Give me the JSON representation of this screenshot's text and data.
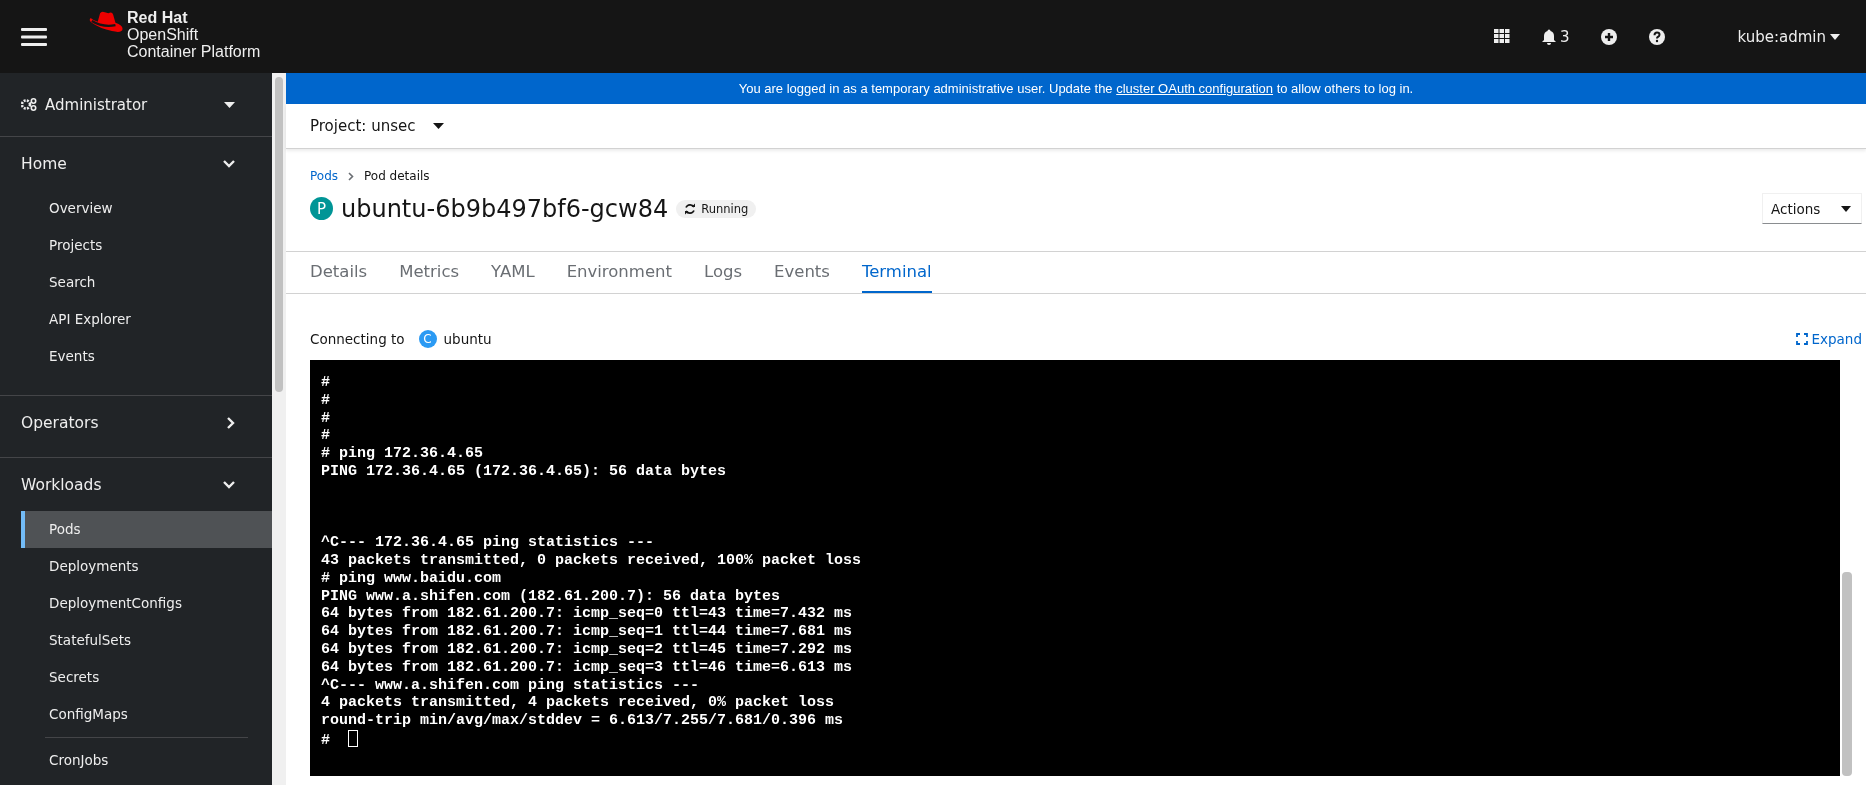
{
  "masthead": {
    "brand": "Red Hat",
    "product": "OpenShift",
    "product_sub": "Container Platform",
    "notifications": "3",
    "user": "kube:admin"
  },
  "sidebar": {
    "perspective": "Administrator",
    "sections": [
      {
        "label": "Home",
        "expanded": true,
        "items": [
          {
            "label": "Overview",
            "selected": false,
            "divider_before": false
          },
          {
            "label": "Projects",
            "selected": false,
            "divider_before": false
          },
          {
            "label": "Search",
            "selected": false,
            "divider_before": false
          },
          {
            "label": "API Explorer",
            "selected": false,
            "divider_before": false
          },
          {
            "label": "Events",
            "selected": false,
            "divider_before": false
          }
        ]
      },
      {
        "label": "Operators",
        "expanded": false
      },
      {
        "label": "Workloads",
        "expanded": true,
        "items": [
          {
            "label": "Pods",
            "selected": true,
            "divider_before": false
          },
          {
            "label": "Deployments",
            "selected": false,
            "divider_before": false
          },
          {
            "label": "DeploymentConfigs",
            "selected": false,
            "divider_before": false
          },
          {
            "label": "StatefulSets",
            "selected": false,
            "divider_before": false
          },
          {
            "label": "Secrets",
            "selected": false,
            "divider_before": false
          },
          {
            "label": "ConfigMaps",
            "selected": false,
            "divider_before": false
          },
          {
            "label": "CronJobs",
            "selected": false,
            "divider_before": true
          }
        ]
      }
    ]
  },
  "banner": {
    "text_before": "You are logged in as a temporary administrative user. Update the",
    "link": "cluster OAuth configuration",
    "text_after": "to allow others to log in."
  },
  "project": {
    "label": "Project: unsec"
  },
  "breadcrumb": [
    {
      "label": "Pods",
      "kind": "link"
    },
    {
      "label": "Pod details",
      "kind": "current"
    }
  ],
  "resource": {
    "badge": "P",
    "name": "ubuntu-6b9b497bf6-gcw84",
    "status": "Running",
    "actions": "Actions"
  },
  "tabs": [
    {
      "label": "Details",
      "selected": false
    },
    {
      "label": "Metrics",
      "selected": false
    },
    {
      "label": "YAML",
      "selected": false
    },
    {
      "label": "Environment",
      "selected": false
    },
    {
      "label": "Logs",
      "selected": false
    },
    {
      "label": "Events",
      "selected": false
    },
    {
      "label": "Terminal",
      "selected": true
    }
  ],
  "terminal": {
    "connecting_label": "Connecting to",
    "container_badge": "C",
    "container": "ubuntu",
    "expand": "Expand",
    "cursor": true,
    "output": "#\n#\n#\n#\n# ping 172.36.4.65\nPING 172.36.4.65 (172.36.4.65): 56 data bytes\n\n\n\n^C--- 172.36.4.65 ping statistics ---\n43 packets transmitted, 0 packets received, 100% packet loss\n# ping www.baidu.com\nPING www.a.shifen.com (182.61.200.7): 56 data bytes\n64 bytes from 182.61.200.7: icmp_seq=0 ttl=43 time=7.432 ms\n64 bytes from 182.61.200.7: icmp_seq=1 ttl=44 time=7.681 ms\n64 bytes from 182.61.200.7: icmp_seq=2 ttl=45 time=7.292 ms\n64 bytes from 182.61.200.7: icmp_seq=3 ttl=46 time=6.613 ms\n^C--- www.a.shifen.com ping statistics ---\n4 packets transmitted, 4 packets received, 0% packet loss\nround-trip min/avg/max/stddev = 6.613/7.255/7.681/0.396 ms\n#"
  }
}
